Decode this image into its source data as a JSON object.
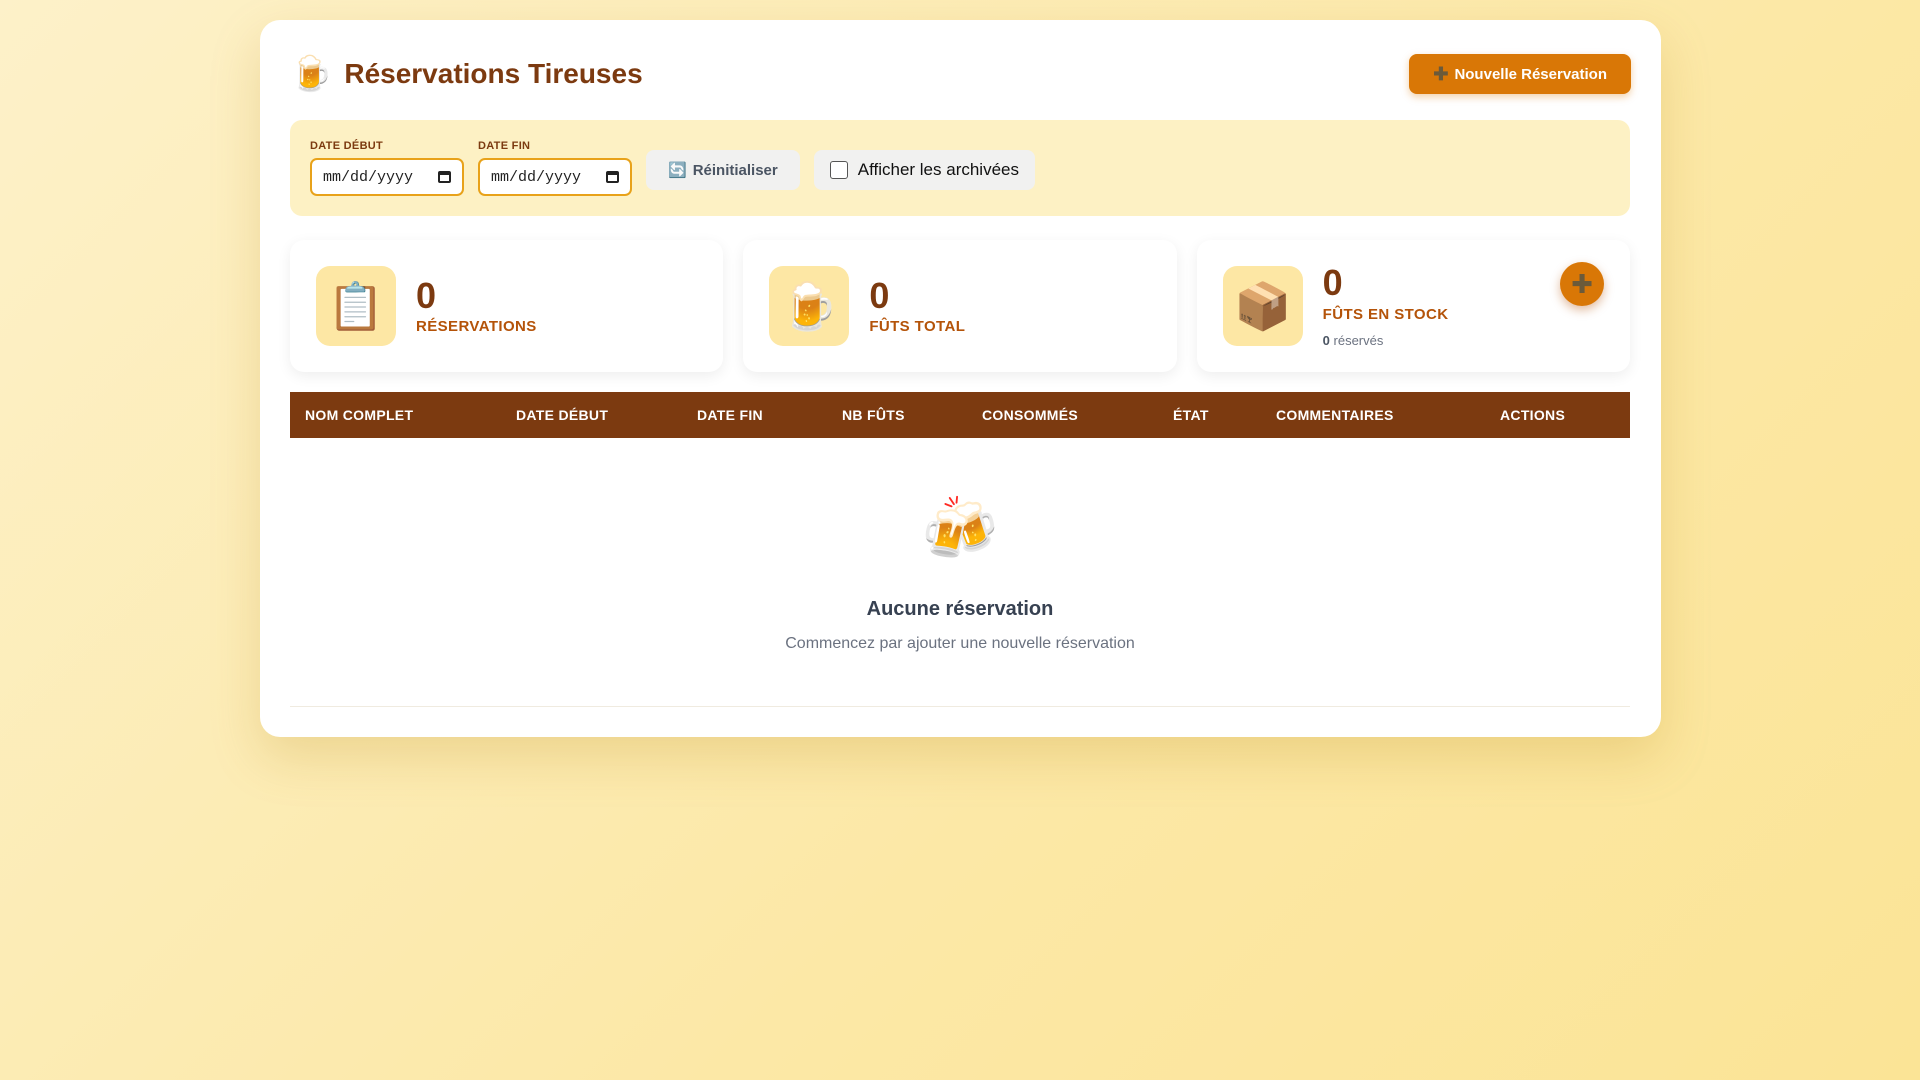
{
  "header": {
    "icon": "beer-mug-icon",
    "title": "Réservations Tireuses",
    "new_button_label": "Nouvelle Réservation",
    "new_button_icon": "plus-icon"
  },
  "filters": {
    "date_start_label": "DATE DÉBUT",
    "date_start_value": "mm/dd/yyyy",
    "date_end_label": "DATE FIN",
    "date_end_value": "mm/dd/yyyy",
    "reset_label": "Réinitialiser",
    "reset_icon": "refresh-icon",
    "archive_label": "Afficher les archivées",
    "archive_checked": false
  },
  "stats": [
    {
      "icon": "clipboard-icon",
      "value": "0",
      "label": "RÉSERVATIONS"
    },
    {
      "icon": "beer-mug-icon",
      "value": "0",
      "label": "FÛTS TOTAL"
    },
    {
      "icon": "package-icon",
      "value": "0",
      "label": "FÛTS EN STOCK",
      "sub_value": "0",
      "sub_label": "réservés"
    }
  ],
  "table": {
    "columns": [
      "NOM COMPLET",
      "DATE DÉBUT",
      "DATE FIN",
      "NB FÛTS",
      "CONSOMMÉS",
      "ÉTAT",
      "COMMENTAIRES",
      "ACTIONS"
    ],
    "rows": []
  },
  "empty_state": {
    "icon": "clinking-beer-mugs-icon",
    "title": "Aucune réservation",
    "subtitle": "Commencez par ajouter une nouvelle réservation"
  },
  "colors": {
    "primary": "#7c3a10",
    "accent": "#d97706",
    "filter_bg": "#fdf1c4",
    "icon_bg": "#fde7a4"
  }
}
